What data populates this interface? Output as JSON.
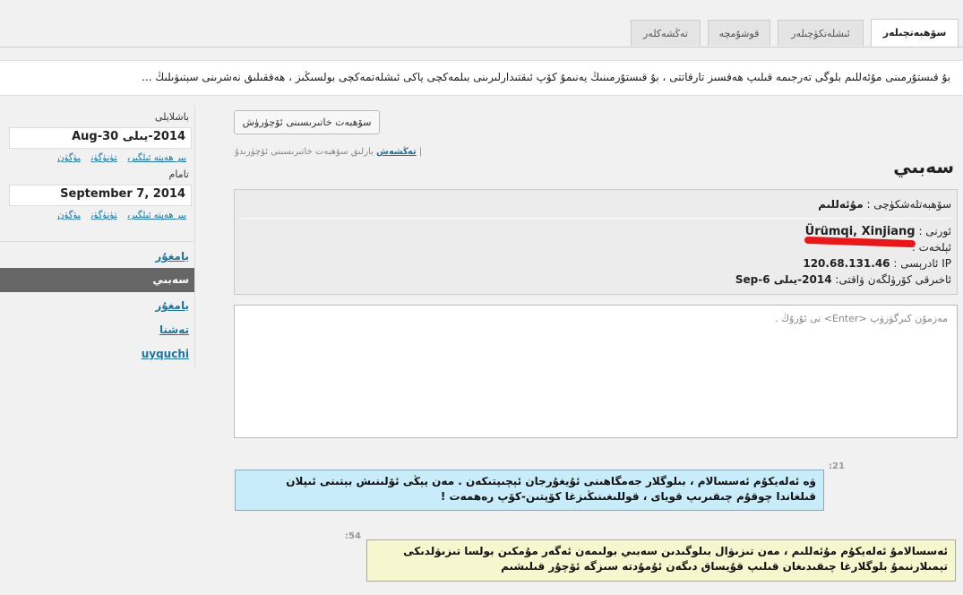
{
  "tabs": [
    {
      "label": "سۆھبەتچىلەر",
      "active": true
    },
    {
      "label": "ئىشلەتكۈچىلەر",
      "active": false
    },
    {
      "label": "قوشۇمچە",
      "active": false
    },
    {
      "label": "تەڭشەكلەر",
      "active": false
    }
  ],
  "notice": "بۇ قىستۇرمىنى مۇئەللىم بلوگى تەرجىمە قىلىپ ھەقسىز تارقاتتى ، بۇ قىستۇرمىنىڭ يەنىمۇ كۆپ ئىقتىدارلىرىنى بىلمەكچى ياكى ئىشلەتمەكچى بولسىڭىز ، ھەققىلىق نەشرىنى سېتىۋىلىڭ ...",
  "sidebar": {
    "start_label": "باشلايلى",
    "start_date": "2014-يىلى 30-Aug",
    "end_label": "تامام",
    "end_date": "September 7, 2014",
    "date_links": [
      "بىر ھەپتە ئىلگىرى",
      "تۈنۈگۈن",
      "بۈگۈن"
    ],
    "nav": [
      {
        "label": "يامغۇر",
        "active": false
      },
      {
        "label": "سەبىي",
        "active": true
      },
      {
        "label": "يامغۇر",
        "active": false
      },
      {
        "label": "تەشنا",
        "active": false
      },
      {
        "label": "uyquchi",
        "active": false
      }
    ]
  },
  "main": {
    "button_label": "سۆھبەت خاتىرىسىنى ئۆچۈرۈش",
    "sublinks_text": "بارلىق سۆھبەت خاتىرىسىنى ئۆچۈرىدۇ |",
    "sublinks_link": "تەڭشەش",
    "heading": "سەبىي",
    "info": {
      "operator_label": "سۆھبەتلەشكۈچى :",
      "operator_value": "مۇئەللىم",
      "location_label": "ئورنى :",
      "location_value": "Ürümqi, Xinjiang",
      "email_label": "ئېلخەت :",
      "ip_label": "IP ئادرېسى :",
      "ip_value": "120.68.131.46",
      "last_seen_label": "ئاخىرقى كۆرۈلگەن ۋاقتى:",
      "last_seen_value": "2014-يىلى 6-Sep"
    },
    "input_placeholder": "مەزمۇن كىرگۈزۈپ <Enter> نى ئۇرۇڭ .",
    "messages": [
      {
        "time": ":21",
        "text": "ۋە ئەلەيكۇم ئەسسالام ، بىلوگلار جەمگاھىنى ئۇيغۇرجان ئېچىپتىكەن . مەن يېڭى ئۆلىنىش بېتىنى ئىپلان قىلغاندا چوقۇم چىقىرىپ قويای ، قوللىغىنىڭىزغا كۆپتىن-كۆپ رەھمەت !"
      },
      {
        "time": ":54",
        "text": "ئەسسالامۇ ئەلەيكۇم مۇئەللىم ، مەن تىزىۋال بىلوگىدىن سەبىي بولىمەن ئەگەر مۇمكىن بولسا تىزىۋلدىكى تېمىلارنىمۇ بلوگلارغا چىقىدىغان قىلىپ قۇيساق دىگەن ئۇمۇدتە سىزگە ئۆچۇر قىلىشىم"
      }
    ]
  },
  "colors": {
    "accent": "#21759b",
    "red_mark": "#e8171a",
    "blue_bubble": "#c8ecfa",
    "yellow_bubble": "#f7f7cf"
  }
}
